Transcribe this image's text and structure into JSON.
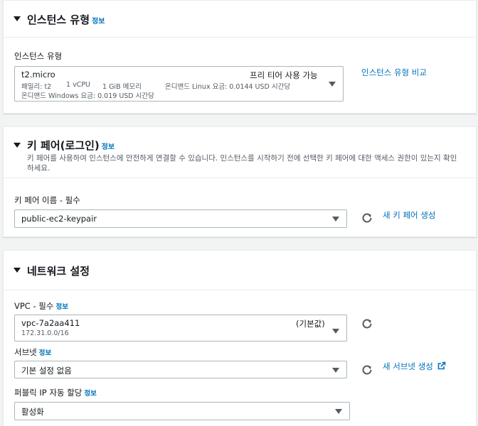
{
  "instance_type": {
    "title": "인스턴스 유형",
    "info": "정보",
    "field_label": "인스턴스 유형",
    "selected": {
      "name": "t2.micro",
      "free_tier": "프리 티어 사용 가능",
      "family": "패밀리: t2",
      "vcpu": "1 vCPU",
      "memory": "1 GiB 메모리",
      "linux_price": "온디맨드 Linux 요금: 0.0144 USD 시간당",
      "windows_price": "온디맨드 Windows 요금: 0.019 USD 시간당"
    },
    "compare_link": "인스턴스 유형 비교"
  },
  "key_pair": {
    "title": "키 페어(로그인)",
    "info": "정보",
    "description": "키 페어를 사용하여 인스턴스에 안전하게 연결할 수 있습니다. 인스턴스를 시작하기 전에 선택한 키 페어에 대한 액세스 권한이 있는지 확인하세요.",
    "field_label": "키 페어 이름 - 필수",
    "selected": "public-ec2-keypair",
    "create_link": "새 키 페어 생성"
  },
  "network": {
    "title": "네트워크 설정",
    "vpc": {
      "label": "VPC - 필수",
      "info": "정보",
      "selected": "vpc-7a2aa411",
      "default_tag": "(기본값)",
      "cidr": "172.31.0.0/16"
    },
    "subnet": {
      "label": "서브넷",
      "info": "정보",
      "selected": "기본 설정 없음",
      "create_link": "새 서브넷 생성"
    },
    "public_ip": {
      "label": "퍼블릭 IP 자동 할당",
      "info": "정보",
      "selected": "활성화"
    }
  },
  "icons": {
    "refresh": "refresh-icon",
    "external": "external-link-icon",
    "caret": "caret-down-icon"
  },
  "colors": {
    "link": "#0073bb",
    "text": "#16191f",
    "secondary": "#545b64",
    "border": "#aab7b8",
    "background": "#f2f3f3"
  }
}
